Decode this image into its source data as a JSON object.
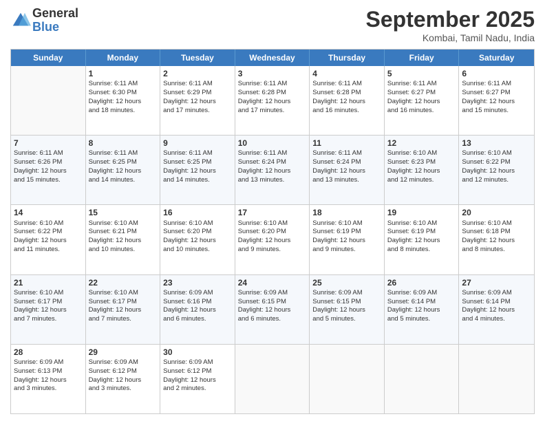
{
  "logo": {
    "general": "General",
    "blue": "Blue"
  },
  "title": "September 2025",
  "location": "Kombai, Tamil Nadu, India",
  "days": [
    "Sunday",
    "Monday",
    "Tuesday",
    "Wednesday",
    "Thursday",
    "Friday",
    "Saturday"
  ],
  "weeks": [
    [
      {
        "day": "",
        "info": ""
      },
      {
        "day": "1",
        "info": "Sunrise: 6:11 AM\nSunset: 6:30 PM\nDaylight: 12 hours\nand 18 minutes."
      },
      {
        "day": "2",
        "info": "Sunrise: 6:11 AM\nSunset: 6:29 PM\nDaylight: 12 hours\nand 17 minutes."
      },
      {
        "day": "3",
        "info": "Sunrise: 6:11 AM\nSunset: 6:28 PM\nDaylight: 12 hours\nand 17 minutes."
      },
      {
        "day": "4",
        "info": "Sunrise: 6:11 AM\nSunset: 6:28 PM\nDaylight: 12 hours\nand 16 minutes."
      },
      {
        "day": "5",
        "info": "Sunrise: 6:11 AM\nSunset: 6:27 PM\nDaylight: 12 hours\nand 16 minutes."
      },
      {
        "day": "6",
        "info": "Sunrise: 6:11 AM\nSunset: 6:27 PM\nDaylight: 12 hours\nand 15 minutes."
      }
    ],
    [
      {
        "day": "7",
        "info": "Sunrise: 6:11 AM\nSunset: 6:26 PM\nDaylight: 12 hours\nand 15 minutes."
      },
      {
        "day": "8",
        "info": "Sunrise: 6:11 AM\nSunset: 6:25 PM\nDaylight: 12 hours\nand 14 minutes."
      },
      {
        "day": "9",
        "info": "Sunrise: 6:11 AM\nSunset: 6:25 PM\nDaylight: 12 hours\nand 14 minutes."
      },
      {
        "day": "10",
        "info": "Sunrise: 6:11 AM\nSunset: 6:24 PM\nDaylight: 12 hours\nand 13 minutes."
      },
      {
        "day": "11",
        "info": "Sunrise: 6:11 AM\nSunset: 6:24 PM\nDaylight: 12 hours\nand 13 minutes."
      },
      {
        "day": "12",
        "info": "Sunrise: 6:10 AM\nSunset: 6:23 PM\nDaylight: 12 hours\nand 12 minutes."
      },
      {
        "day": "13",
        "info": "Sunrise: 6:10 AM\nSunset: 6:22 PM\nDaylight: 12 hours\nand 12 minutes."
      }
    ],
    [
      {
        "day": "14",
        "info": "Sunrise: 6:10 AM\nSunset: 6:22 PM\nDaylight: 12 hours\nand 11 minutes."
      },
      {
        "day": "15",
        "info": "Sunrise: 6:10 AM\nSunset: 6:21 PM\nDaylight: 12 hours\nand 10 minutes."
      },
      {
        "day": "16",
        "info": "Sunrise: 6:10 AM\nSunset: 6:20 PM\nDaylight: 12 hours\nand 10 minutes."
      },
      {
        "day": "17",
        "info": "Sunrise: 6:10 AM\nSunset: 6:20 PM\nDaylight: 12 hours\nand 9 minutes."
      },
      {
        "day": "18",
        "info": "Sunrise: 6:10 AM\nSunset: 6:19 PM\nDaylight: 12 hours\nand 9 minutes."
      },
      {
        "day": "19",
        "info": "Sunrise: 6:10 AM\nSunset: 6:19 PM\nDaylight: 12 hours\nand 8 minutes."
      },
      {
        "day": "20",
        "info": "Sunrise: 6:10 AM\nSunset: 6:18 PM\nDaylight: 12 hours\nand 8 minutes."
      }
    ],
    [
      {
        "day": "21",
        "info": "Sunrise: 6:10 AM\nSunset: 6:17 PM\nDaylight: 12 hours\nand 7 minutes."
      },
      {
        "day": "22",
        "info": "Sunrise: 6:10 AM\nSunset: 6:17 PM\nDaylight: 12 hours\nand 7 minutes."
      },
      {
        "day": "23",
        "info": "Sunrise: 6:09 AM\nSunset: 6:16 PM\nDaylight: 12 hours\nand 6 minutes."
      },
      {
        "day": "24",
        "info": "Sunrise: 6:09 AM\nSunset: 6:15 PM\nDaylight: 12 hours\nand 6 minutes."
      },
      {
        "day": "25",
        "info": "Sunrise: 6:09 AM\nSunset: 6:15 PM\nDaylight: 12 hours\nand 5 minutes."
      },
      {
        "day": "26",
        "info": "Sunrise: 6:09 AM\nSunset: 6:14 PM\nDaylight: 12 hours\nand 5 minutes."
      },
      {
        "day": "27",
        "info": "Sunrise: 6:09 AM\nSunset: 6:14 PM\nDaylight: 12 hours\nand 4 minutes."
      }
    ],
    [
      {
        "day": "28",
        "info": "Sunrise: 6:09 AM\nSunset: 6:13 PM\nDaylight: 12 hours\nand 3 minutes."
      },
      {
        "day": "29",
        "info": "Sunrise: 6:09 AM\nSunset: 6:12 PM\nDaylight: 12 hours\nand 3 minutes."
      },
      {
        "day": "30",
        "info": "Sunrise: 6:09 AM\nSunset: 6:12 PM\nDaylight: 12 hours\nand 2 minutes."
      },
      {
        "day": "",
        "info": ""
      },
      {
        "day": "",
        "info": ""
      },
      {
        "day": "",
        "info": ""
      },
      {
        "day": "",
        "info": ""
      }
    ]
  ]
}
